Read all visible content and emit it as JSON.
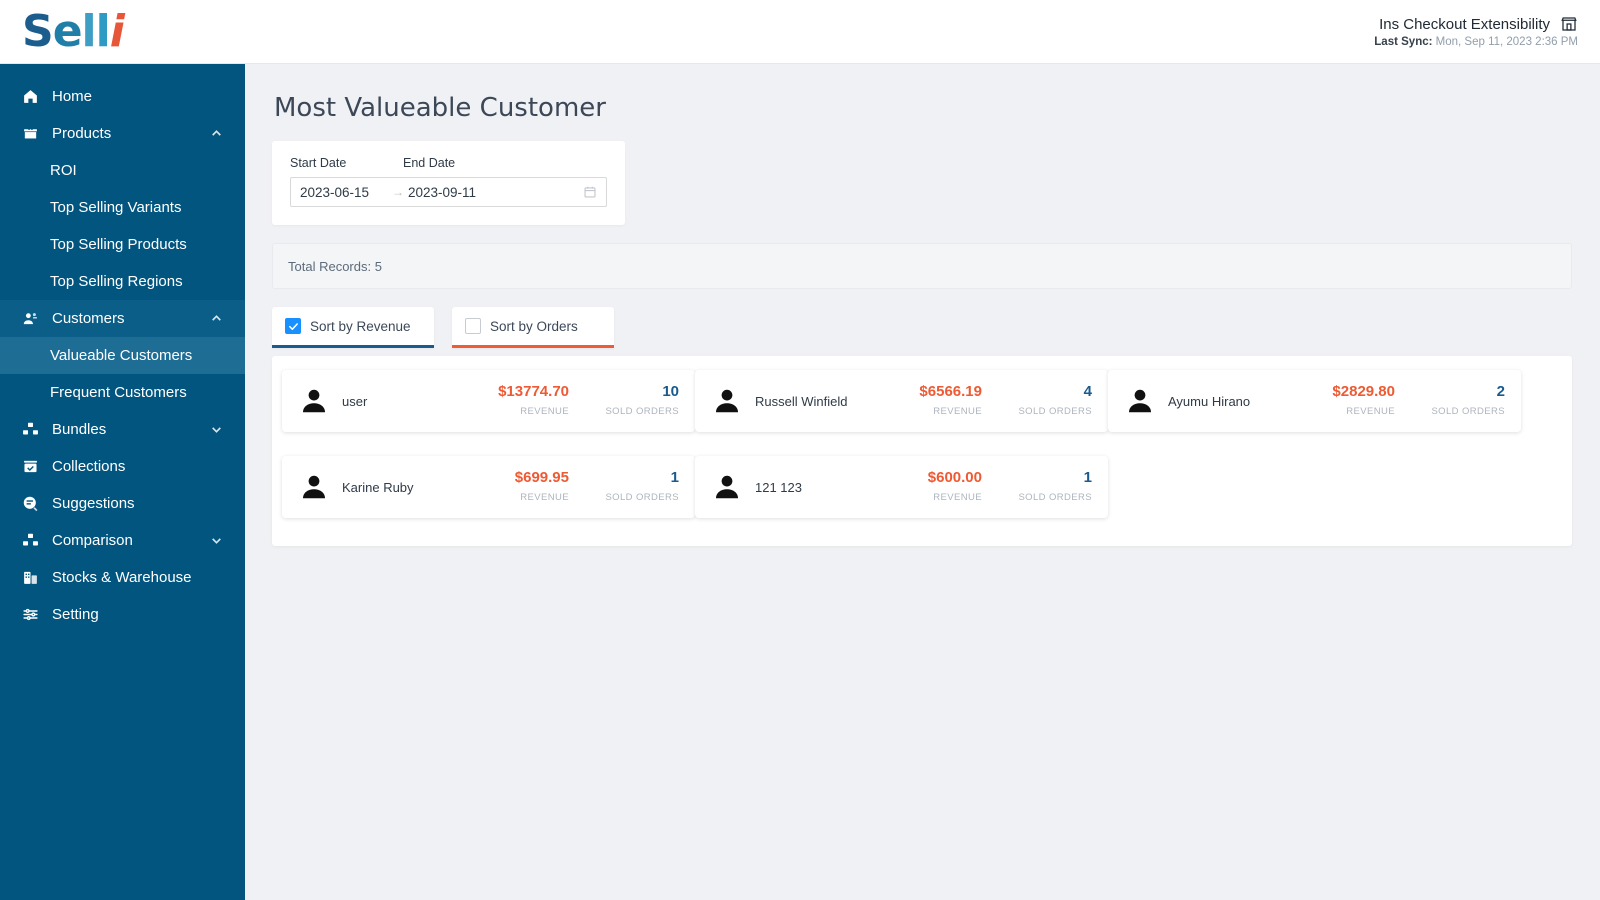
{
  "header": {
    "logo_text": "Selli",
    "shop_name": "Ins Checkout Extensibility",
    "store_icon": "store-icon",
    "sync_label": "Last Sync:",
    "sync_value": " Mon, Sep 11, 2023 2:36 PM"
  },
  "sidebar": {
    "items": [
      {
        "label": "Home",
        "icon": "home-icon",
        "type": "item"
      },
      {
        "label": "Products",
        "icon": "box-icon",
        "type": "parent",
        "chevron": "chevron-up-icon",
        "expanded": true
      },
      {
        "label": "ROI",
        "type": "sub"
      },
      {
        "label": "Top Selling Variants",
        "type": "sub"
      },
      {
        "label": "Top Selling Products",
        "type": "sub"
      },
      {
        "label": "Top Selling Regions",
        "type": "sub"
      },
      {
        "label": "Customers",
        "icon": "users-icon",
        "type": "parent",
        "chevron": "chevron-up-icon",
        "expanded": true
      },
      {
        "label": "Valueable Customers",
        "type": "sub",
        "active": true
      },
      {
        "label": "Frequent Customers",
        "type": "sub"
      },
      {
        "label": "Bundles",
        "icon": "bundles-icon",
        "type": "parent",
        "chevron": "chevron-down-icon",
        "expanded": false
      },
      {
        "label": "Collections",
        "icon": "collections-icon",
        "type": "item"
      },
      {
        "label": "Suggestions",
        "icon": "suggestions-icon",
        "type": "item"
      },
      {
        "label": "Comparison",
        "icon": "comparison-icon",
        "type": "parent",
        "chevron": "chevron-down-icon",
        "expanded": false
      },
      {
        "label": "Stocks & Warehouse",
        "icon": "stocks-icon",
        "type": "item"
      },
      {
        "label": "Setting",
        "icon": "settings-icon",
        "type": "item"
      }
    ]
  },
  "main": {
    "page_title": "Most Valueable Customer",
    "date_filter": {
      "start_label": "Start Date",
      "end_label": "End Date",
      "start_value": "2023-06-15",
      "end_value": "2023-09-11",
      "separator": "→",
      "calendar_icon": "calendar-icon"
    },
    "records_text": "Total Records: 5",
    "sort_options": [
      {
        "label": "Sort by Revenue",
        "checked": true,
        "accent": "#1a5a8e"
      },
      {
        "label": "Sort by Orders",
        "checked": false,
        "accent": "#ef5b32"
      }
    ],
    "metric_captions": {
      "revenue": "REVENUE",
      "orders": "SOLD ORDERS"
    },
    "customers": [
      {
        "name": "user",
        "revenue": "$13774.70",
        "orders": "10"
      },
      {
        "name": "Russell Winfield",
        "revenue": "$6566.19",
        "orders": "4"
      },
      {
        "name": "Ayumu Hirano",
        "revenue": "$2829.80",
        "orders": "2"
      },
      {
        "name": "Karine Ruby",
        "revenue": "$699.95",
        "orders": "1"
      },
      {
        "name": "121 123",
        "revenue": "$600.00",
        "orders": "1"
      }
    ]
  },
  "colors": {
    "sidebar_bg": "#02557f",
    "sidebar_active": "#1e6d94",
    "revenue": "#ee5a33",
    "orders": "#1a5a8e",
    "checkbox": "#1890ff",
    "page_bg": "#f0f1f4"
  }
}
